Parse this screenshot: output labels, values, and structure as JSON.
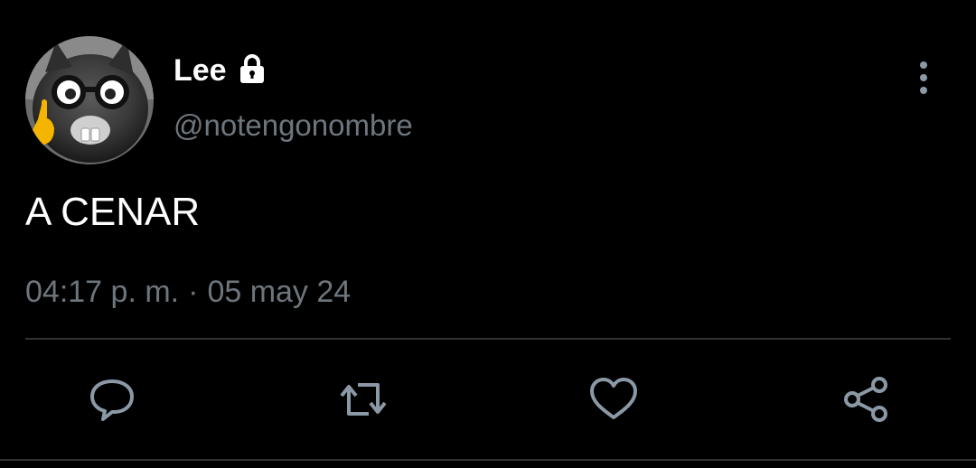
{
  "colors": {
    "background": "#000000",
    "text_primary": "#ffffff",
    "text_secondary": "#6e767d",
    "divider": "#2f3336",
    "icon": "#8b98a5"
  },
  "author": {
    "display_name": "Lee",
    "handle": "@notengonombre",
    "protected_icon": "lock-icon",
    "avatar": "avatar-cat-with-glasses"
  },
  "tweet": {
    "text": "A CENAR",
    "time": "04:17 p. m.",
    "separator": "·",
    "date": "05 may 24"
  },
  "actions": [
    {
      "name": "reply",
      "icon": "comment-icon"
    },
    {
      "name": "retweet",
      "icon": "retweet-icon"
    },
    {
      "name": "like",
      "icon": "heart-icon"
    },
    {
      "name": "share",
      "icon": "share-icon"
    }
  ],
  "menu_icon": "more-vertical-icon"
}
